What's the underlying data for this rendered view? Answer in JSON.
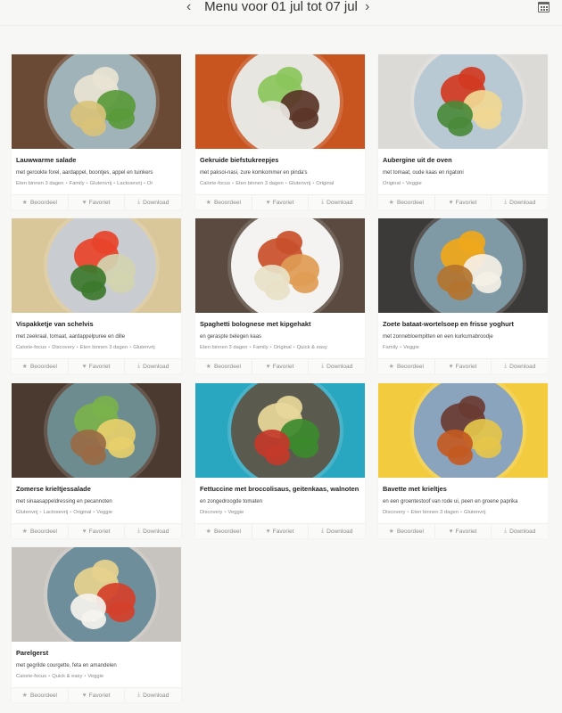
{
  "header": {
    "title": "Menu voor 01 jul tot 07 jul",
    "prev": "‹",
    "next": "›"
  },
  "actions": {
    "rate": "Beoordeel",
    "favorite": "Favoriet",
    "download": "Download"
  },
  "recipes": [
    {
      "name": "Lauwwarme salade",
      "description": "met gerookte forel, aardappel, boontjes, appel en tuinkers",
      "tags": [
        "Eten binnen 3 dagen",
        "Family",
        "Glutenvrij",
        "Lactosevrij",
        "Or"
      ]
    },
    {
      "name": "Gekruide biefstukreepjes",
      "description": "met paksoi-nasi, zure komkommer en pinda's",
      "tags": [
        "Calorie-focus",
        "Eten binnen 3 dagen",
        "Glutenvrij",
        "Original"
      ]
    },
    {
      "name": "Aubergine uit de oven",
      "description": "met tomaat, oude kaas en rigatoni",
      "tags": [
        "Original",
        "Veggie"
      ]
    },
    {
      "name": "Vispakketje van schelvis",
      "description": "met zeekraal, tomaat, aardappelpuree en dille",
      "tags": [
        "Calorie-focus",
        "Discovery",
        "Eten binnen 3 dagen",
        "Glutenvrij"
      ]
    },
    {
      "name": "Spaghetti bolognese met kipgehakt",
      "description": "en geraspte belegen kaas",
      "tags": [
        "Eten binnen 3 dagen",
        "Family",
        "Original",
        "Quick & easy"
      ]
    },
    {
      "name": "Zoete bataat-wortelsoep en frisse yoghurt",
      "description": "met zonnebloempitten en een kurkumabroodje",
      "tags": [
        "Family",
        "Veggie"
      ]
    },
    {
      "name": "Zomerse krieltjessalade",
      "description": "met sinaasappeldressing en pecannoten",
      "tags": [
        "Glutenvrij",
        "Lactosevrij",
        "Original",
        "Veggie"
      ]
    },
    {
      "name": "Fettuccine met broccolisaus, geitenkaas, walnoten",
      "description": "en zongedroogde tomaten",
      "tags": [
        "Discovery",
        "Veggie"
      ]
    },
    {
      "name": "Bavette met krieltjes",
      "description": "en een groentestoof van rode ui, peen en groene paprika",
      "tags": [
        "Discovery",
        "Eten binnen 3 dagen",
        "Glutenvrij"
      ]
    },
    {
      "name": "Parelgerst",
      "description": "met gegrilde courgette, feta en amandelen",
      "tags": [
        "Calorie-focus",
        "Quick & easy",
        "Veggie"
      ]
    }
  ],
  "images": [
    {
      "icon": "salad-photo",
      "bg": "#6b4a35",
      "plate": "#9fb3b8",
      "food": [
        "#e8e3d3",
        "#5a9a3a",
        "#d9c27a"
      ]
    },
    {
      "icon": "beef-salad-photo",
      "bg": "#c8541f",
      "plate": "#e8e6e1",
      "food": [
        "#8ac65a",
        "#5a3528",
        "#e8e6e1"
      ]
    },
    {
      "icon": "pasta-bake-photo",
      "bg": "#dcdad6",
      "plate": "#b9c9d4",
      "food": [
        "#d13a22",
        "#f0d894",
        "#4a8a3a"
      ]
    },
    {
      "icon": "fish-parcel-photo",
      "bg": "#d9c79a",
      "plate": "#c9cdd2",
      "food": [
        "#e8432a",
        "#d2d4b0",
        "#3d7a2e"
      ]
    },
    {
      "icon": "spaghetti-photo",
      "bg": "#5a4a40",
      "plate": "#f4f3f1",
      "food": [
        "#c94f2b",
        "#e09c55",
        "#e8e2c8"
      ]
    },
    {
      "icon": "soup-photo",
      "bg": "#3b3a39",
      "plate": "#7f9aa4",
      "food": [
        "#f0a81a",
        "#f5f0e6",
        "#b3742f"
      ]
    },
    {
      "icon": "potato-salad-photo",
      "bg": "#4a3a30",
      "plate": "#6c8c8f",
      "food": [
        "#7bb24c",
        "#e7cf6b",
        "#9a6a45"
      ]
    },
    {
      "icon": "fettuccine-photo",
      "bg": "#2aa7c0",
      "plate": "#5b5a4e",
      "food": [
        "#e8d89a",
        "#3c8a2e",
        "#c33a2a"
      ]
    },
    {
      "icon": "steak-photo",
      "bg": "#f2cc3e",
      "plate": "#8ba4bd",
      "food": [
        "#6a3b32",
        "#e5c54a",
        "#c35a22"
      ]
    },
    {
      "icon": "barley-photo",
      "bg": "#c7c3bf",
      "plate": "#6f8e9b",
      "food": [
        "#e6d38e",
        "#d4402a",
        "#f5f3ee"
      ]
    }
  ]
}
